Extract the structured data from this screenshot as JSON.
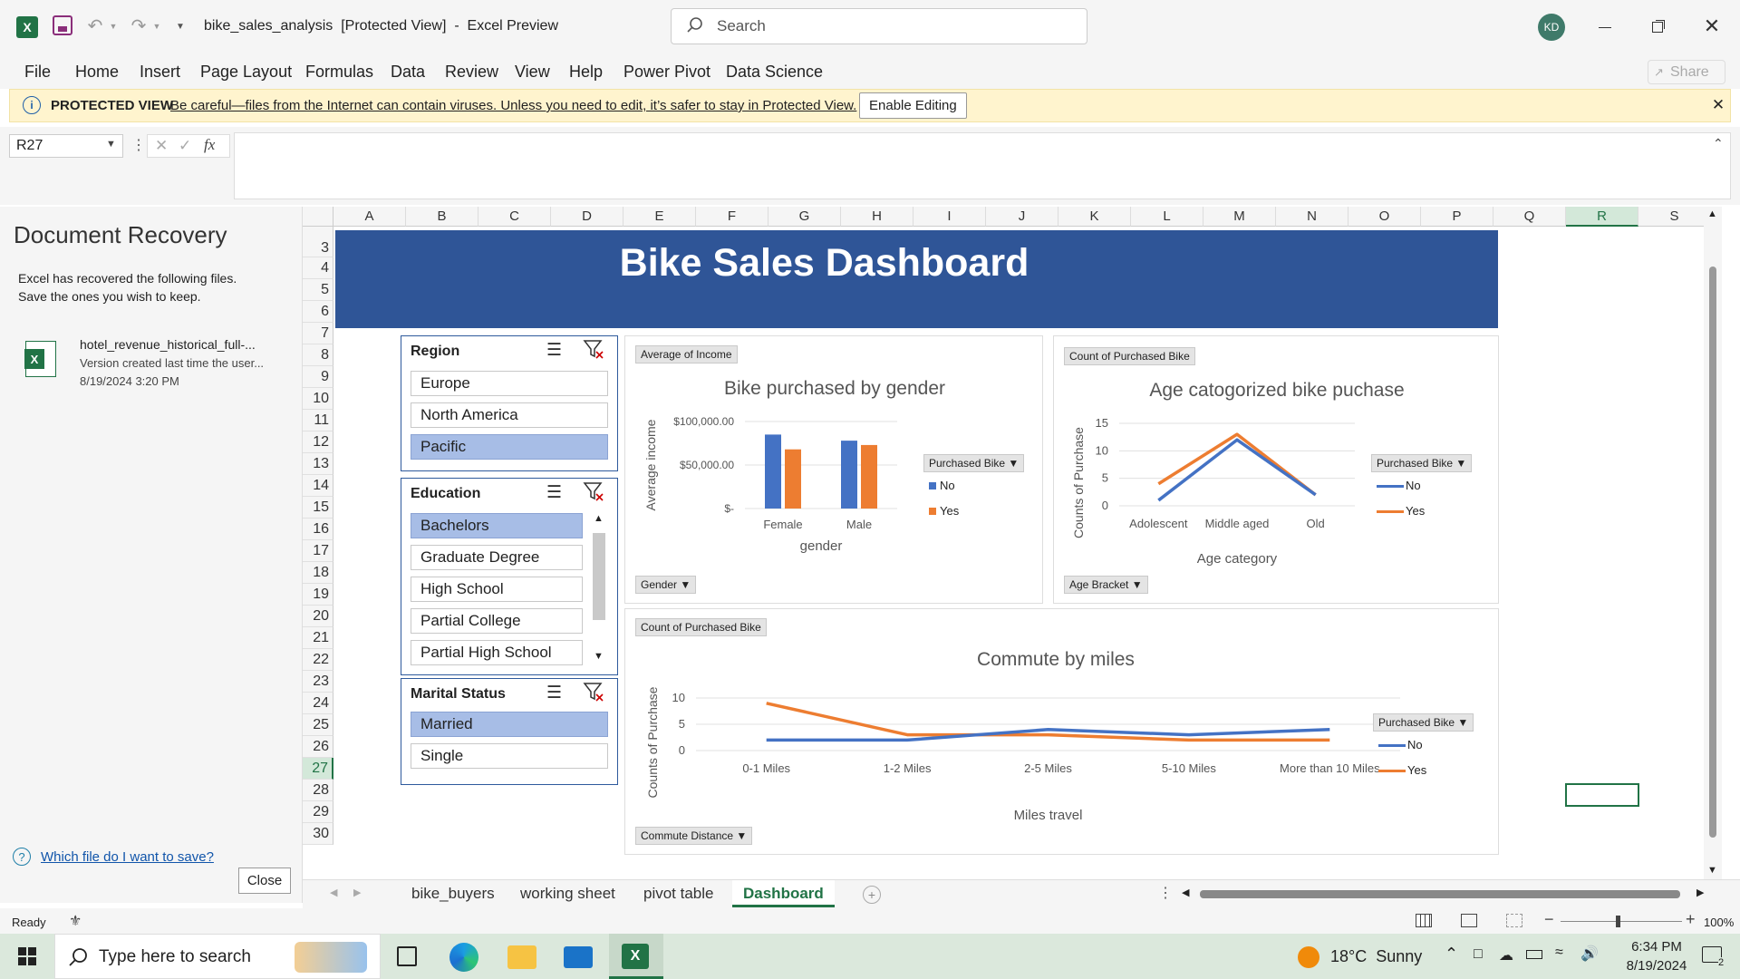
{
  "app": {
    "filename": "bike_sales_analysis",
    "mode": "[Protected View]",
    "separator": "-",
    "appname": "Excel Preview",
    "search_placeholder": "Search",
    "user_initials": "KD",
    "share": "Share"
  },
  "menu": [
    "File",
    "Home",
    "Insert",
    "Page Layout",
    "Formulas",
    "Data",
    "Review",
    "View",
    "Help",
    "Power Pivot",
    "Data Science"
  ],
  "protected": {
    "label": "PROTECTED VIEW",
    "message": "Be careful—files from the Internet can contain viruses. Unless you need to edit, it’s safer to stay in Protected View.",
    "button": "Enable Editing"
  },
  "formula": {
    "namebox": "R27",
    "value": ""
  },
  "recovery": {
    "title": "Document Recovery",
    "desc1": "Excel has recovered the following files.",
    "desc2": "Save the ones you wish to keep.",
    "file_name": "hotel_revenue_historical_full-...",
    "file_version": "Version created last time the user...",
    "file_date": "8/19/2024 3:20 PM",
    "help_link": "Which file do I want to save?",
    "close": "Close"
  },
  "grid": {
    "columns": [
      "A",
      "B",
      "C",
      "D",
      "E",
      "F",
      "G",
      "H",
      "I",
      "J",
      "K",
      "L",
      "M",
      "N",
      "O",
      "P",
      "Q",
      "R",
      "S"
    ],
    "rows": [
      "3",
      "4",
      "5",
      "6",
      "7",
      "8",
      "9",
      "10",
      "11",
      "12",
      "13",
      "14",
      "15",
      "16",
      "17",
      "18",
      "19",
      "20",
      "21",
      "22",
      "23",
      "24",
      "25",
      "26",
      "27",
      "28",
      "29",
      "30"
    ],
    "selected_col": "R",
    "selected_row": "27"
  },
  "dashboard": {
    "title": "Bike Sales Dashboard"
  },
  "slicers": {
    "region": {
      "title": "Region",
      "items": [
        "Europe",
        "North America",
        "Pacific"
      ],
      "selected": [
        2
      ]
    },
    "education": {
      "title": "Education",
      "items": [
        "Bachelors",
        "Graduate Degree",
        "High School",
        "Partial College",
        "Partial High School"
      ],
      "selected": [
        0
      ]
    },
    "marital": {
      "title": "Marital Status",
      "items": [
        "Married",
        "Single"
      ],
      "selected": [
        0
      ]
    }
  },
  "chart_data": [
    {
      "type": "bar",
      "field_button": "Average of Income",
      "title": "Bike purchased by gender",
      "xlabel": "gender",
      "ylabel": "Average income",
      "axis_button": "Gender",
      "legend_title": "Purchased Bike",
      "categories": [
        "Female",
        "Male"
      ],
      "ytick_labels": [
        "$100,000.00",
        "$50,000.00",
        "$-"
      ],
      "yticks": [
        100000,
        50000,
        0
      ],
      "ylim": [
        0,
        100000
      ],
      "series": [
        {
          "name": "No",
          "color": "#4472c4",
          "values": [
            85000,
            78000
          ]
        },
        {
          "name": "Yes",
          "color": "#ed7d31",
          "values": [
            68000,
            73000
          ]
        }
      ],
      "legend": "right"
    },
    {
      "type": "line",
      "field_button": "Count of Purchased Bike",
      "title": "Age catogorized bike puchase",
      "xlabel": "Age category",
      "ylabel": "Counts of Purchase",
      "axis_button": "Age Bracket",
      "legend_title": "Purchased Bike",
      "categories": [
        "Adolescent",
        "Middle aged",
        "Old"
      ],
      "yticks": [
        15,
        10,
        5,
        0
      ],
      "ylim": [
        0,
        15
      ],
      "series": [
        {
          "name": "No",
          "color": "#4472c4",
          "values": [
            1,
            12,
            2
          ]
        },
        {
          "name": "Yes",
          "color": "#ed7d31",
          "values": [
            4,
            13,
            2
          ]
        }
      ],
      "legend": "right"
    },
    {
      "type": "line",
      "field_button": "Count of Purchased Bike",
      "title": "Commute by miles",
      "xlabel": "Miles travel",
      "ylabel": "Counts of Purchase",
      "axis_button": "Commute Distance",
      "legend_title": "Purchased Bike",
      "categories": [
        "0-1 Miles",
        "1-2 Miles",
        "2-5 Miles",
        "5-10 Miles",
        "More than 10 Miles"
      ],
      "yticks": [
        10,
        5,
        0
      ],
      "ylim": [
        0,
        10
      ],
      "series": [
        {
          "name": "No",
          "color": "#4472c4",
          "values": [
            2,
            2,
            4,
            3,
            4
          ]
        },
        {
          "name": "Yes",
          "color": "#ed7d31",
          "values": [
            9,
            3,
            3,
            2,
            2
          ]
        }
      ],
      "legend": "right"
    }
  ],
  "sheets": {
    "tabs": [
      "bike_buyers",
      "working sheet",
      "pivot table",
      "Dashboard"
    ],
    "active": 3
  },
  "status": {
    "ready": "Ready",
    "zoom": "100%"
  },
  "taskbar": {
    "search": "Type here to search",
    "weather": "18°C  Sunny",
    "time": "6:34 PM",
    "date": "8/19/2024",
    "notif": "2"
  },
  "colors": {
    "excel_green": "#217346",
    "dashboard_blue": "#2f5597",
    "series_no": "#4472c4",
    "series_yes": "#ed7d31",
    "slicer_selected": "#a7bde6"
  }
}
